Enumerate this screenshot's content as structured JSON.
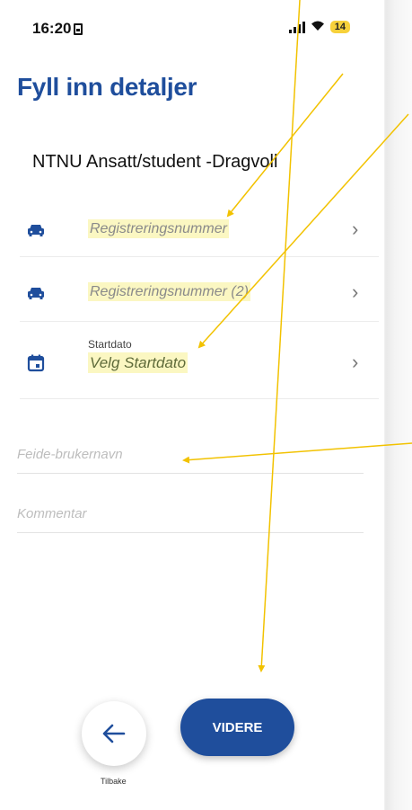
{
  "status_bar": {
    "time": "16:20",
    "battery": "14",
    "sim_icon": "sim-card-icon",
    "signal_icon": "signal-bars-icon",
    "wifi_icon": "wifi-icon"
  },
  "header": {
    "title": "Fyll inn detaljer"
  },
  "location": {
    "name": "NTNU Ansatt/student -Dragvoll"
  },
  "list": {
    "items": [
      {
        "icon": "car-icon",
        "label": "Registreringsnummer",
        "sublabel": ""
      },
      {
        "icon": "car-icon",
        "label": "Registreringsnummer (2)",
        "sublabel": ""
      },
      {
        "icon": "calendar-icon",
        "label": "Velg Startdato",
        "sublabel": "Startdato"
      }
    ]
  },
  "form": {
    "feide_placeholder": "Feide-brukernavn",
    "comment_placeholder": "Kommentar"
  },
  "footer": {
    "back_label": "Tilbake",
    "next_label": "VIDERE"
  },
  "colors": {
    "brand_blue": "#1f4e9c",
    "highlight_yellow": "#fbf7c2",
    "annotation_arrow": "#f2c200"
  }
}
